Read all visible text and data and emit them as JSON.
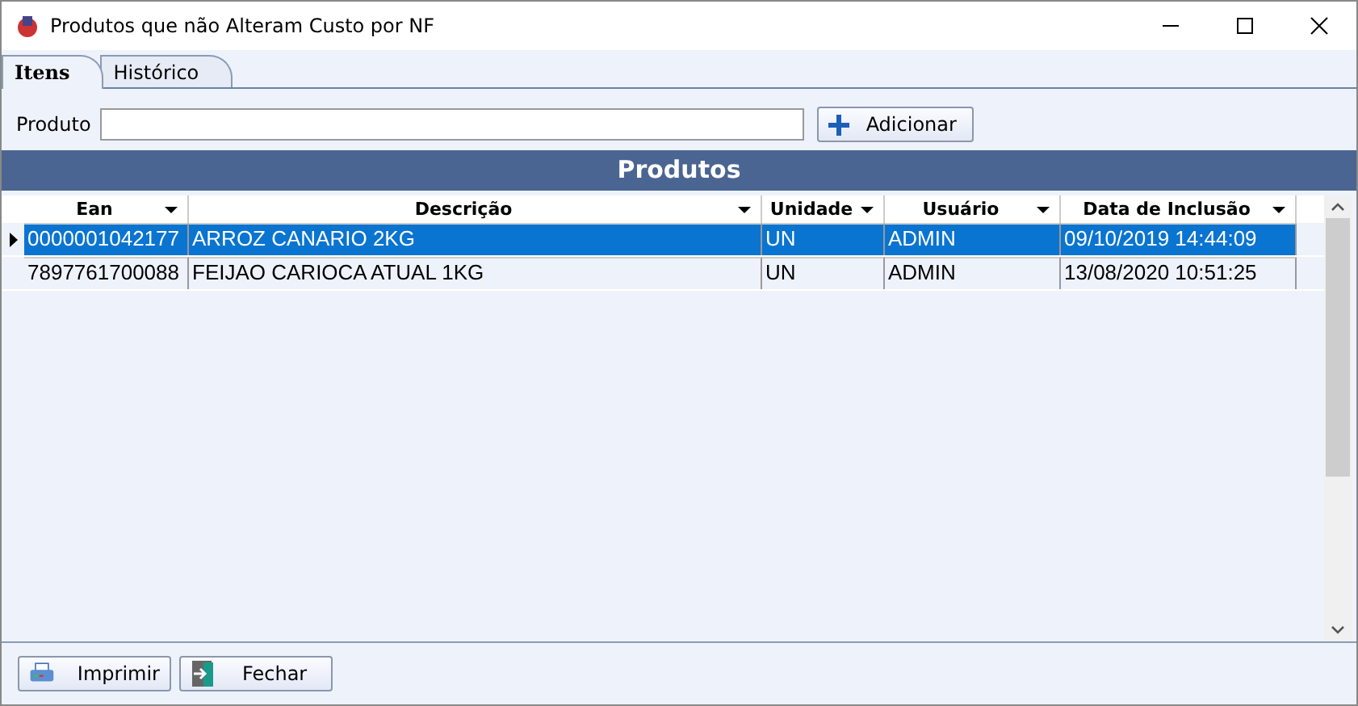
{
  "window": {
    "title": "Produtos que não Alteram Custo por NF"
  },
  "tabs": [
    {
      "label": "Itens",
      "selected": true
    },
    {
      "label": "Histórico",
      "selected": false
    }
  ],
  "product_field": {
    "label": "Produto"
  },
  "add_button": {
    "label": "Adicionar"
  },
  "panel_title": "Produtos",
  "table": {
    "columns": [
      "Ean",
      "Descrição",
      "Unidade",
      "Usuário",
      "Data de Inclusão"
    ],
    "rows": [
      {
        "cells": [
          "0000001042177",
          "ARROZ CANARIO 2KG",
          "UN",
          "ADMIN",
          "09/10/2019 14:44:09"
        ],
        "selected": true
      },
      {
        "cells": [
          "7897761700088",
          "FEIJAO CARIOCA ATUAL 1KG",
          "UN",
          "ADMIN",
          "13/08/2020 10:51:25"
        ],
        "selected": false
      }
    ]
  },
  "buttons": [
    {
      "kind": "print",
      "label": "Imprimir"
    },
    {
      "kind": "close",
      "label": "Fechar"
    }
  ]
}
